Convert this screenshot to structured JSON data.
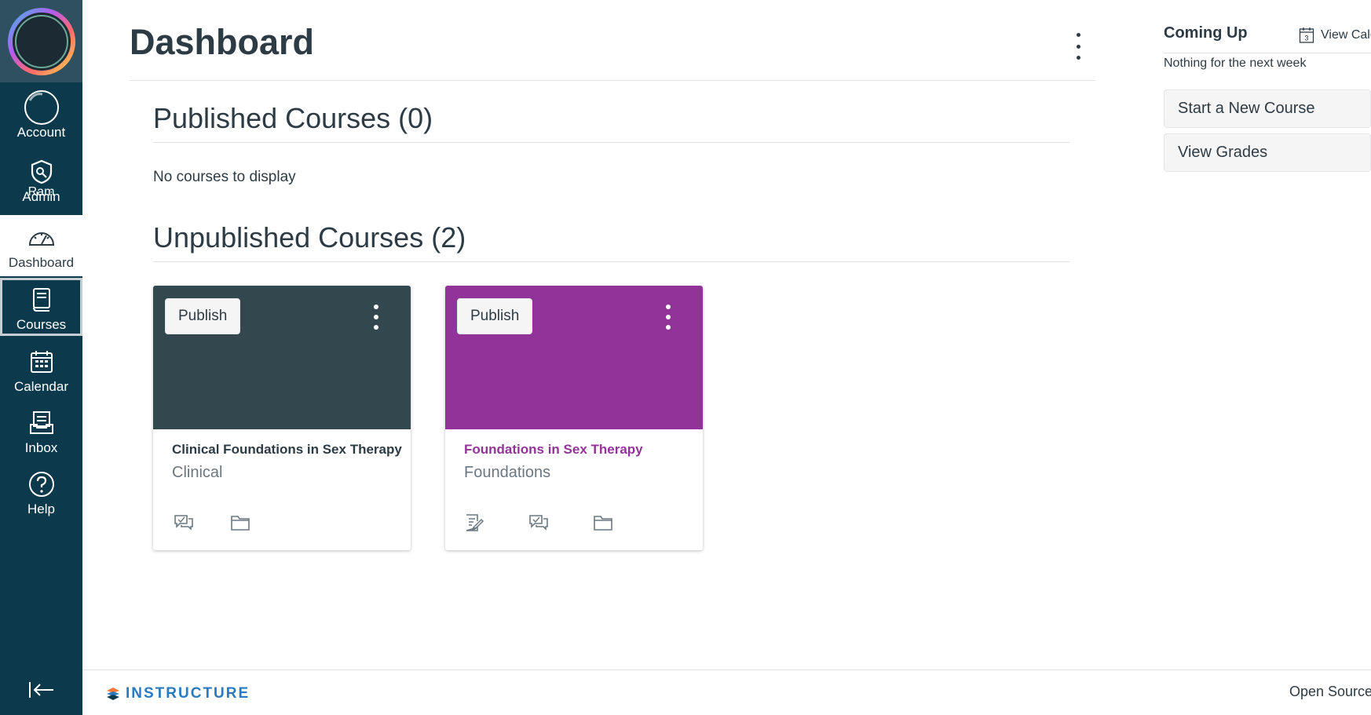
{
  "nav": {
    "items": [
      {
        "label": "Account",
        "icon": "avatar-icon",
        "avatar_text": "Ram"
      },
      {
        "label": "Admin",
        "icon": "shield-icon"
      },
      {
        "label": "Dashboard",
        "icon": "dashboard-icon"
      },
      {
        "label": "Courses",
        "icon": "courses-icon"
      },
      {
        "label": "Calendar",
        "icon": "calendar-icon"
      },
      {
        "label": "Inbox",
        "icon": "inbox-icon"
      },
      {
        "label": "Help",
        "icon": "help-icon"
      }
    ]
  },
  "main": {
    "title": "Dashboard",
    "published": {
      "heading": "Published Courses (0)",
      "empty": "No courses to display"
    },
    "unpublished": {
      "heading": "Unpublished Courses (2)",
      "cards": [
        {
          "publish_label": "Publish",
          "name": "Clinical Foundations in Sex Therapy",
          "subtitle": "Clinical",
          "color": "#33474f",
          "name_color": "#2d3b45"
        },
        {
          "publish_label": "Publish",
          "name": "Foundations in Sex Therapy",
          "subtitle": "Foundations",
          "color": "#913398",
          "name_color": "#913398"
        }
      ]
    }
  },
  "sidebar": {
    "coming_up": "Coming Up",
    "view_calendar": "View Cale",
    "calendar_day": "3",
    "nothing": "Nothing for the next week",
    "start_course": "Start a New Course",
    "view_grades": "View Grades"
  },
  "footer": {
    "logo_text": "INSTRUCTURE",
    "link": "Open Source"
  },
  "colors": {
    "nav_bg": "#0c3a4c",
    "accent_link": "#2a7abf"
  }
}
